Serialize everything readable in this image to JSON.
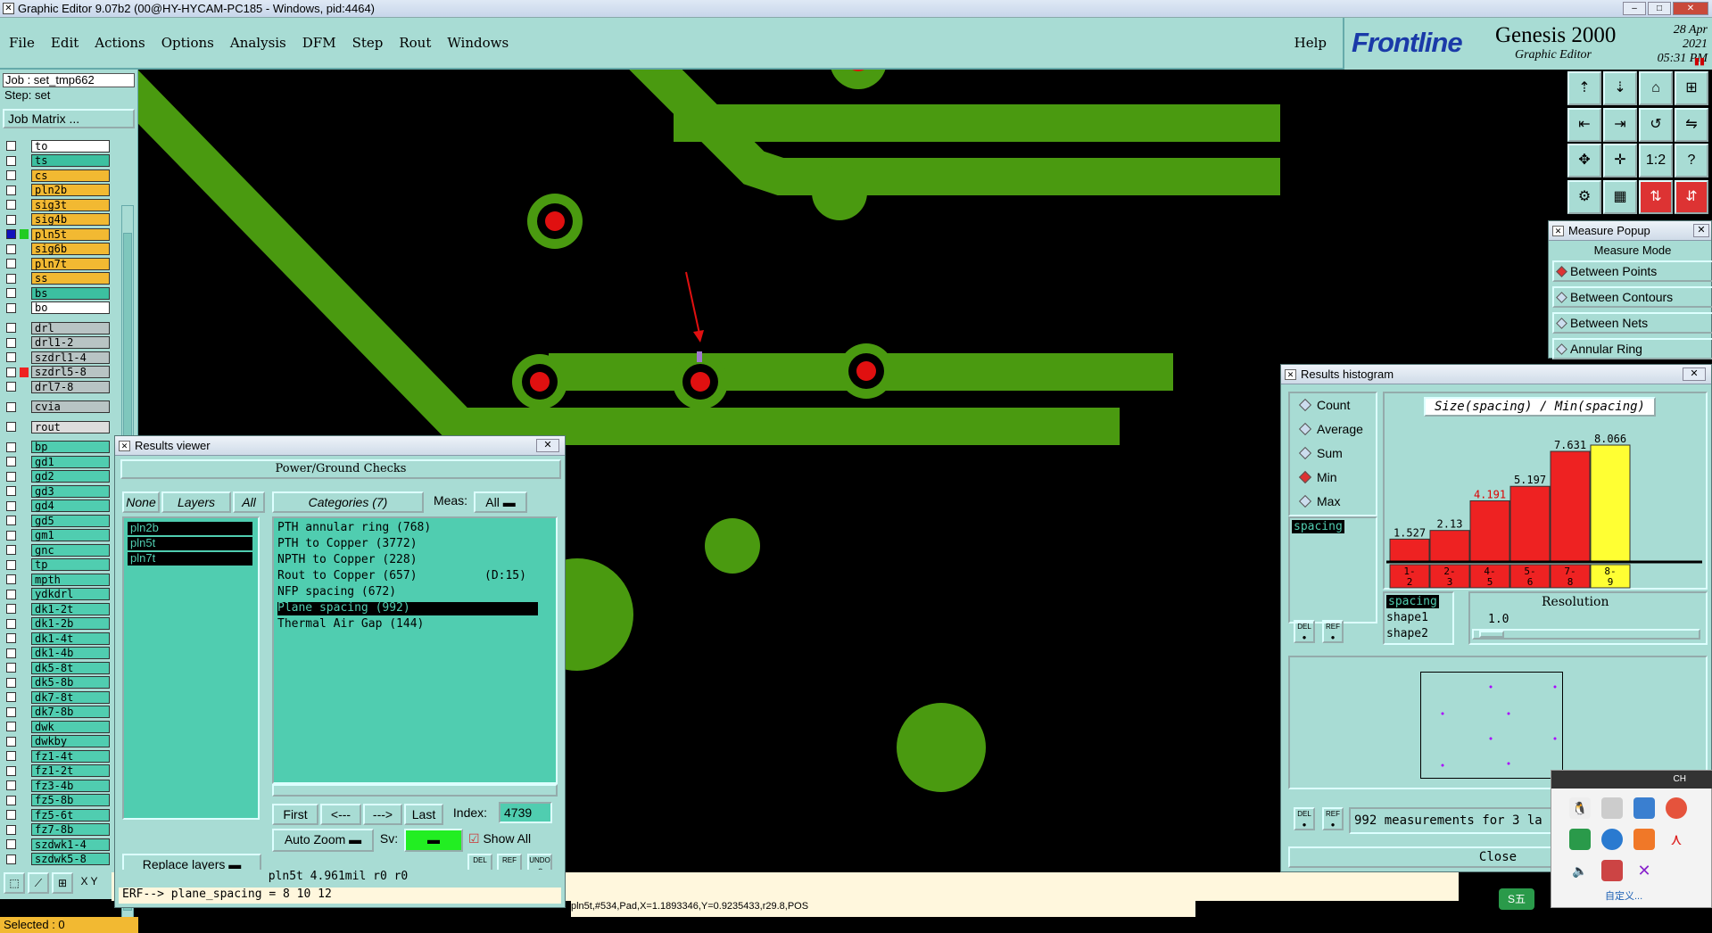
{
  "titlebar": {
    "title": "Graphic Editor 9.07b2 (00@HY-HYCAM-PC185 - Windows, pid:4464)"
  },
  "menu": {
    "items": [
      "File",
      "Edit",
      "Actions",
      "Options",
      "Analysis",
      "DFM",
      "Step",
      "Rout",
      "Windows"
    ],
    "help": "Help"
  },
  "brand": {
    "logo": "Frontline",
    "product": "Genesis 2000",
    "subtitle": "Graphic Editor",
    "date": "28 Apr 2021",
    "time": "05:31 PM"
  },
  "job": {
    "job": "Job : set_tmp662",
    "step": "Step: set",
    "matrix": "Job Matrix ..."
  },
  "layers": [
    {
      "name": "to",
      "color": "#ffffff"
    },
    {
      "name": "ts",
      "color": "#3cc0a0"
    },
    {
      "name": "cs",
      "color": "#f2b932"
    },
    {
      "name": "pln2b",
      "color": "#f2b932"
    },
    {
      "name": "sig3t",
      "color": "#f2b932"
    },
    {
      "name": "sig4b",
      "color": "#f2b932"
    },
    {
      "name": "pln5t",
      "color": "#f2b932"
    },
    {
      "name": "sig6b",
      "color": "#f2b932"
    },
    {
      "name": "pln7t",
      "color": "#f2b932"
    },
    {
      "name": "ss",
      "color": "#f2b932"
    },
    {
      "name": "bs",
      "color": "#3cc0a0"
    },
    {
      "name": "bo",
      "color": "#ffffff"
    },
    {
      "name": "drl",
      "color": "#b8c4c4"
    },
    {
      "name": "drl1-2",
      "color": "#b8c4c4"
    },
    {
      "name": "szdrl1-4",
      "color": "#b8c4c4"
    },
    {
      "name": "szdrl5-8",
      "color": "#b8c4c4"
    },
    {
      "name": "drl7-8",
      "color": "#b8c4c4"
    },
    {
      "name": "cvia",
      "color": "#b8c4c4"
    },
    {
      "name": "rout",
      "color": "#dddddd"
    },
    {
      "name": "bp",
      "color": "#50cdb0"
    },
    {
      "name": "gd1",
      "color": "#50cdb0"
    },
    {
      "name": "gd2",
      "color": "#50cdb0"
    },
    {
      "name": "gd3",
      "color": "#50cdb0"
    },
    {
      "name": "gd4",
      "color": "#50cdb0"
    },
    {
      "name": "gd5",
      "color": "#50cdb0"
    },
    {
      "name": "gm1",
      "color": "#50cdb0"
    },
    {
      "name": "gnc",
      "color": "#50cdb0"
    },
    {
      "name": "tp",
      "color": "#50cdb0"
    },
    {
      "name": "mpth",
      "color": "#50cdb0"
    },
    {
      "name": "ydkdrl",
      "color": "#50cdb0"
    },
    {
      "name": "dk1-2t",
      "color": "#50cdb0"
    },
    {
      "name": "dk1-2b",
      "color": "#50cdb0"
    },
    {
      "name": "dk1-4t",
      "color": "#50cdb0"
    },
    {
      "name": "dk1-4b",
      "color": "#50cdb0"
    },
    {
      "name": "dk5-8t",
      "color": "#50cdb0"
    },
    {
      "name": "dk5-8b",
      "color": "#50cdb0"
    },
    {
      "name": "dk7-8t",
      "color": "#50cdb0"
    },
    {
      "name": "dk7-8b",
      "color": "#50cdb0"
    },
    {
      "name": "dwk",
      "color": "#50cdb0"
    },
    {
      "name": "dwkby",
      "color": "#50cdb0"
    },
    {
      "name": "fz1-4t",
      "color": "#50cdb0"
    },
    {
      "name": "fz1-2t",
      "color": "#50cdb0"
    },
    {
      "name": "fz3-4b",
      "color": "#50cdb0"
    },
    {
      "name": "fz5-8b",
      "color": "#50cdb0"
    },
    {
      "name": "fz5-6t",
      "color": "#50cdb0"
    },
    {
      "name": "fz7-8b",
      "color": "#50cdb0"
    },
    {
      "name": "szdwk1-4",
      "color": "#50cdb0"
    },
    {
      "name": "szdwk5-8",
      "color": "#50cdb0"
    }
  ],
  "selected": "Selected : 0",
  "tools": {
    "xy": "X Y"
  },
  "results_viewer": {
    "title": "Results viewer",
    "header": "Power/Ground Checks",
    "none": "None",
    "layers": "Layers",
    "all": "All",
    "categories": "Categories (7)",
    "meas_label": "Meas:",
    "meas_value": "All",
    "layer_list": [
      "pln2b",
      "pln5t",
      "pln7t"
    ],
    "category_items": [
      "PTH annular ring (768)",
      "PTH to Copper (3772)",
      "NPTH to Copper (228)",
      "Rout to Copper (657)",
      "NFP spacing (672)",
      "Plane spacing (992)",
      "Thermal Air Gap (144)"
    ],
    "rout_extra": "(D:15)",
    "first": "First",
    "prev": "<---",
    "next": "--->",
    "last": "Last",
    "index_label": "Index:",
    "index_value": "4739",
    "auto_zoom": "Auto Zoom",
    "sv": "Sv:",
    "show_all": "Show All",
    "replace_layers": "Replace layers",
    "del": "DEL",
    "ref": "REF",
    "undo": "UNDO",
    "status1": "pln5t 4.961mil  r0  r0",
    "status2": "ERF--> plane_spacing = 8 10 12"
  },
  "histogram": {
    "title": "Results histogram",
    "options": [
      "Count",
      "Average",
      "Sum",
      "Min",
      "Max"
    ],
    "active_option": "Min",
    "field": "spacing",
    "chart_title": "Size(spacing) / Min(spacing)",
    "resolution_label": "Resolution",
    "resolution_value": "1.0",
    "fields": [
      "spacing",
      "shape1",
      "shape2"
    ],
    "summary": "992 measurements for 3 la",
    "close": "Close",
    "del": "DEL",
    "ref": "REF"
  },
  "chart_data": {
    "type": "bar",
    "categories": [
      "1-2",
      "2-3",
      "4-5",
      "5-6",
      "7-8",
      "8-9"
    ],
    "values": [
      1.527,
      2.13,
      4.191,
      5.197,
      7.631,
      8.066
    ],
    "labels": [
      "1.527",
      "2.13",
      "4.191",
      "5.197",
      "7.631",
      "8.066"
    ],
    "colors": [
      "#ee2222",
      "#ee2222",
      "#ee2222",
      "#ee2222",
      "#ee2222",
      "#ffff33"
    ],
    "title": "Size(spacing) / Min(spacing)"
  },
  "measure_popup": {
    "title": "Measure Popup",
    "mode": "Measure Mode",
    "options": [
      "Between Points",
      "Between Contours",
      "Between Nets",
      "Annular Ring"
    ],
    "active": "Between Points"
  },
  "status": {
    "coords": "pln5t,#534,Pad,X=1.1893346,Y=0.9235433,r29.8,POS"
  },
  "tray": {
    "ch": "CH",
    "customize": "自定义..."
  }
}
